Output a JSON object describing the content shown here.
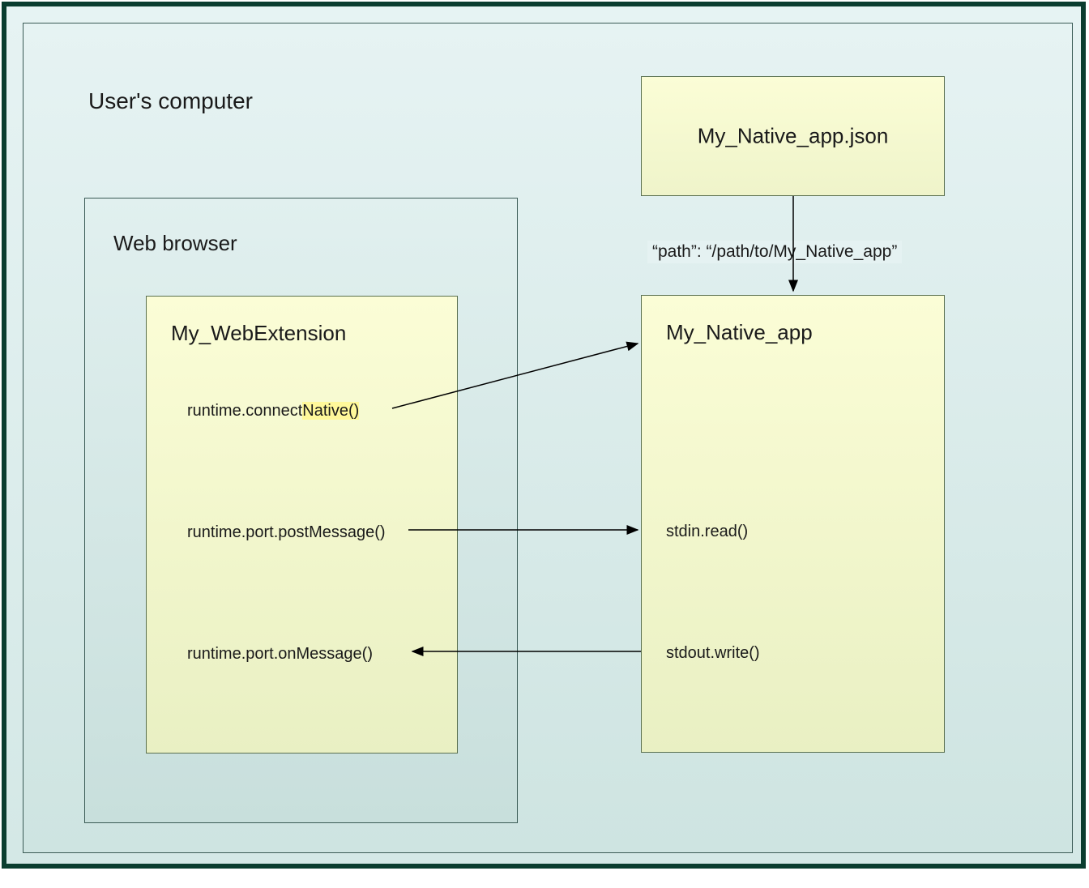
{
  "container": {
    "user_computer_label": "User's computer",
    "web_browser_label": "Web browser"
  },
  "webextension": {
    "title": "My_WebExtension",
    "api_calls": {
      "connect": "runtime.connectNative()",
      "post": "runtime.port.postMessage()",
      "on": "runtime.port.onMessage()"
    }
  },
  "native_manifest": {
    "title": "My_Native_app.json",
    "path_label": "“path”: “/path/to/My_Native_app”"
  },
  "native_app": {
    "title": "My_Native_app",
    "io": {
      "stdin": "stdin.read()",
      "stdout": "stdout.write()"
    }
  }
}
